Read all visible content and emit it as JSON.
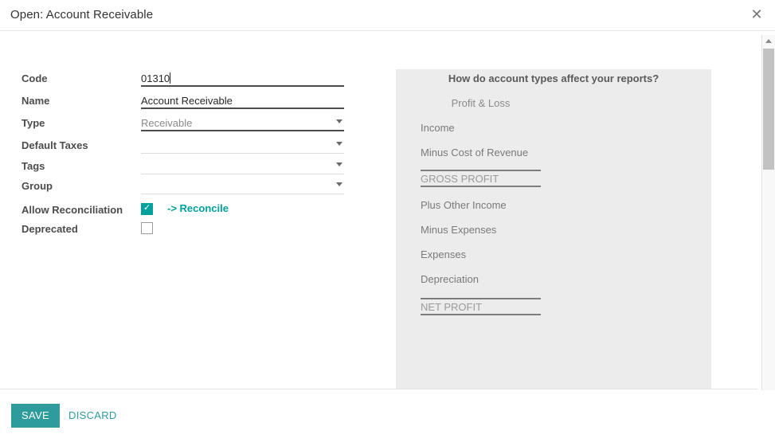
{
  "dialog": {
    "title": "Open: Account Receivable",
    "close_icon": "close-icon",
    "close_glyph": "✕"
  },
  "form": {
    "fields": [
      {
        "label": "Code",
        "value": "01310",
        "type": "text",
        "name": "code"
      },
      {
        "label": "Name",
        "value": "Account Receivable",
        "type": "text",
        "name": "name"
      },
      {
        "label": "Type",
        "value": "Receivable",
        "type": "select",
        "name": "type"
      },
      {
        "label": "Default Taxes",
        "value": "",
        "type": "select",
        "name": "default-taxes"
      },
      {
        "label": "Tags",
        "value": "",
        "type": "select",
        "name": "tags"
      },
      {
        "label": "Group",
        "value": "",
        "type": "select",
        "name": "group"
      },
      {
        "label": "Allow Reconciliation",
        "value": "",
        "type": "checkbox",
        "name": "allow-reconciliation"
      },
      {
        "label": "Deprecated",
        "value": "",
        "type": "checkbox",
        "name": "deprecated"
      }
    ],
    "reconcile_link": "-> Reconcile",
    "allow_reconciliation_checked": true,
    "deprecated_checked": false
  },
  "info_panel": {
    "title": "How do account types affect your reports?",
    "subtitle": "Profit & Loss",
    "lines": [
      "Income",
      "Minus Cost of Revenue"
    ],
    "gross_total": "GROSS PROFIT",
    "lines2": [
      "Plus Other Income",
      "Minus Expenses",
      "Expenses",
      "Depreciation"
    ],
    "net_total": "NET PROFIT"
  },
  "footer": {
    "save_label": "SAVE",
    "discard_label": "DISCARD"
  },
  "scrollbar": {
    "up_arrow_icon": "chevron-up-icon",
    "down_arrow_icon": "chevron-down-icon"
  },
  "colors": {
    "accent": "#00a09d",
    "save_button": "#2e9c9c",
    "panel_bg": "#ececec",
    "label": "#4c4c4c"
  }
}
